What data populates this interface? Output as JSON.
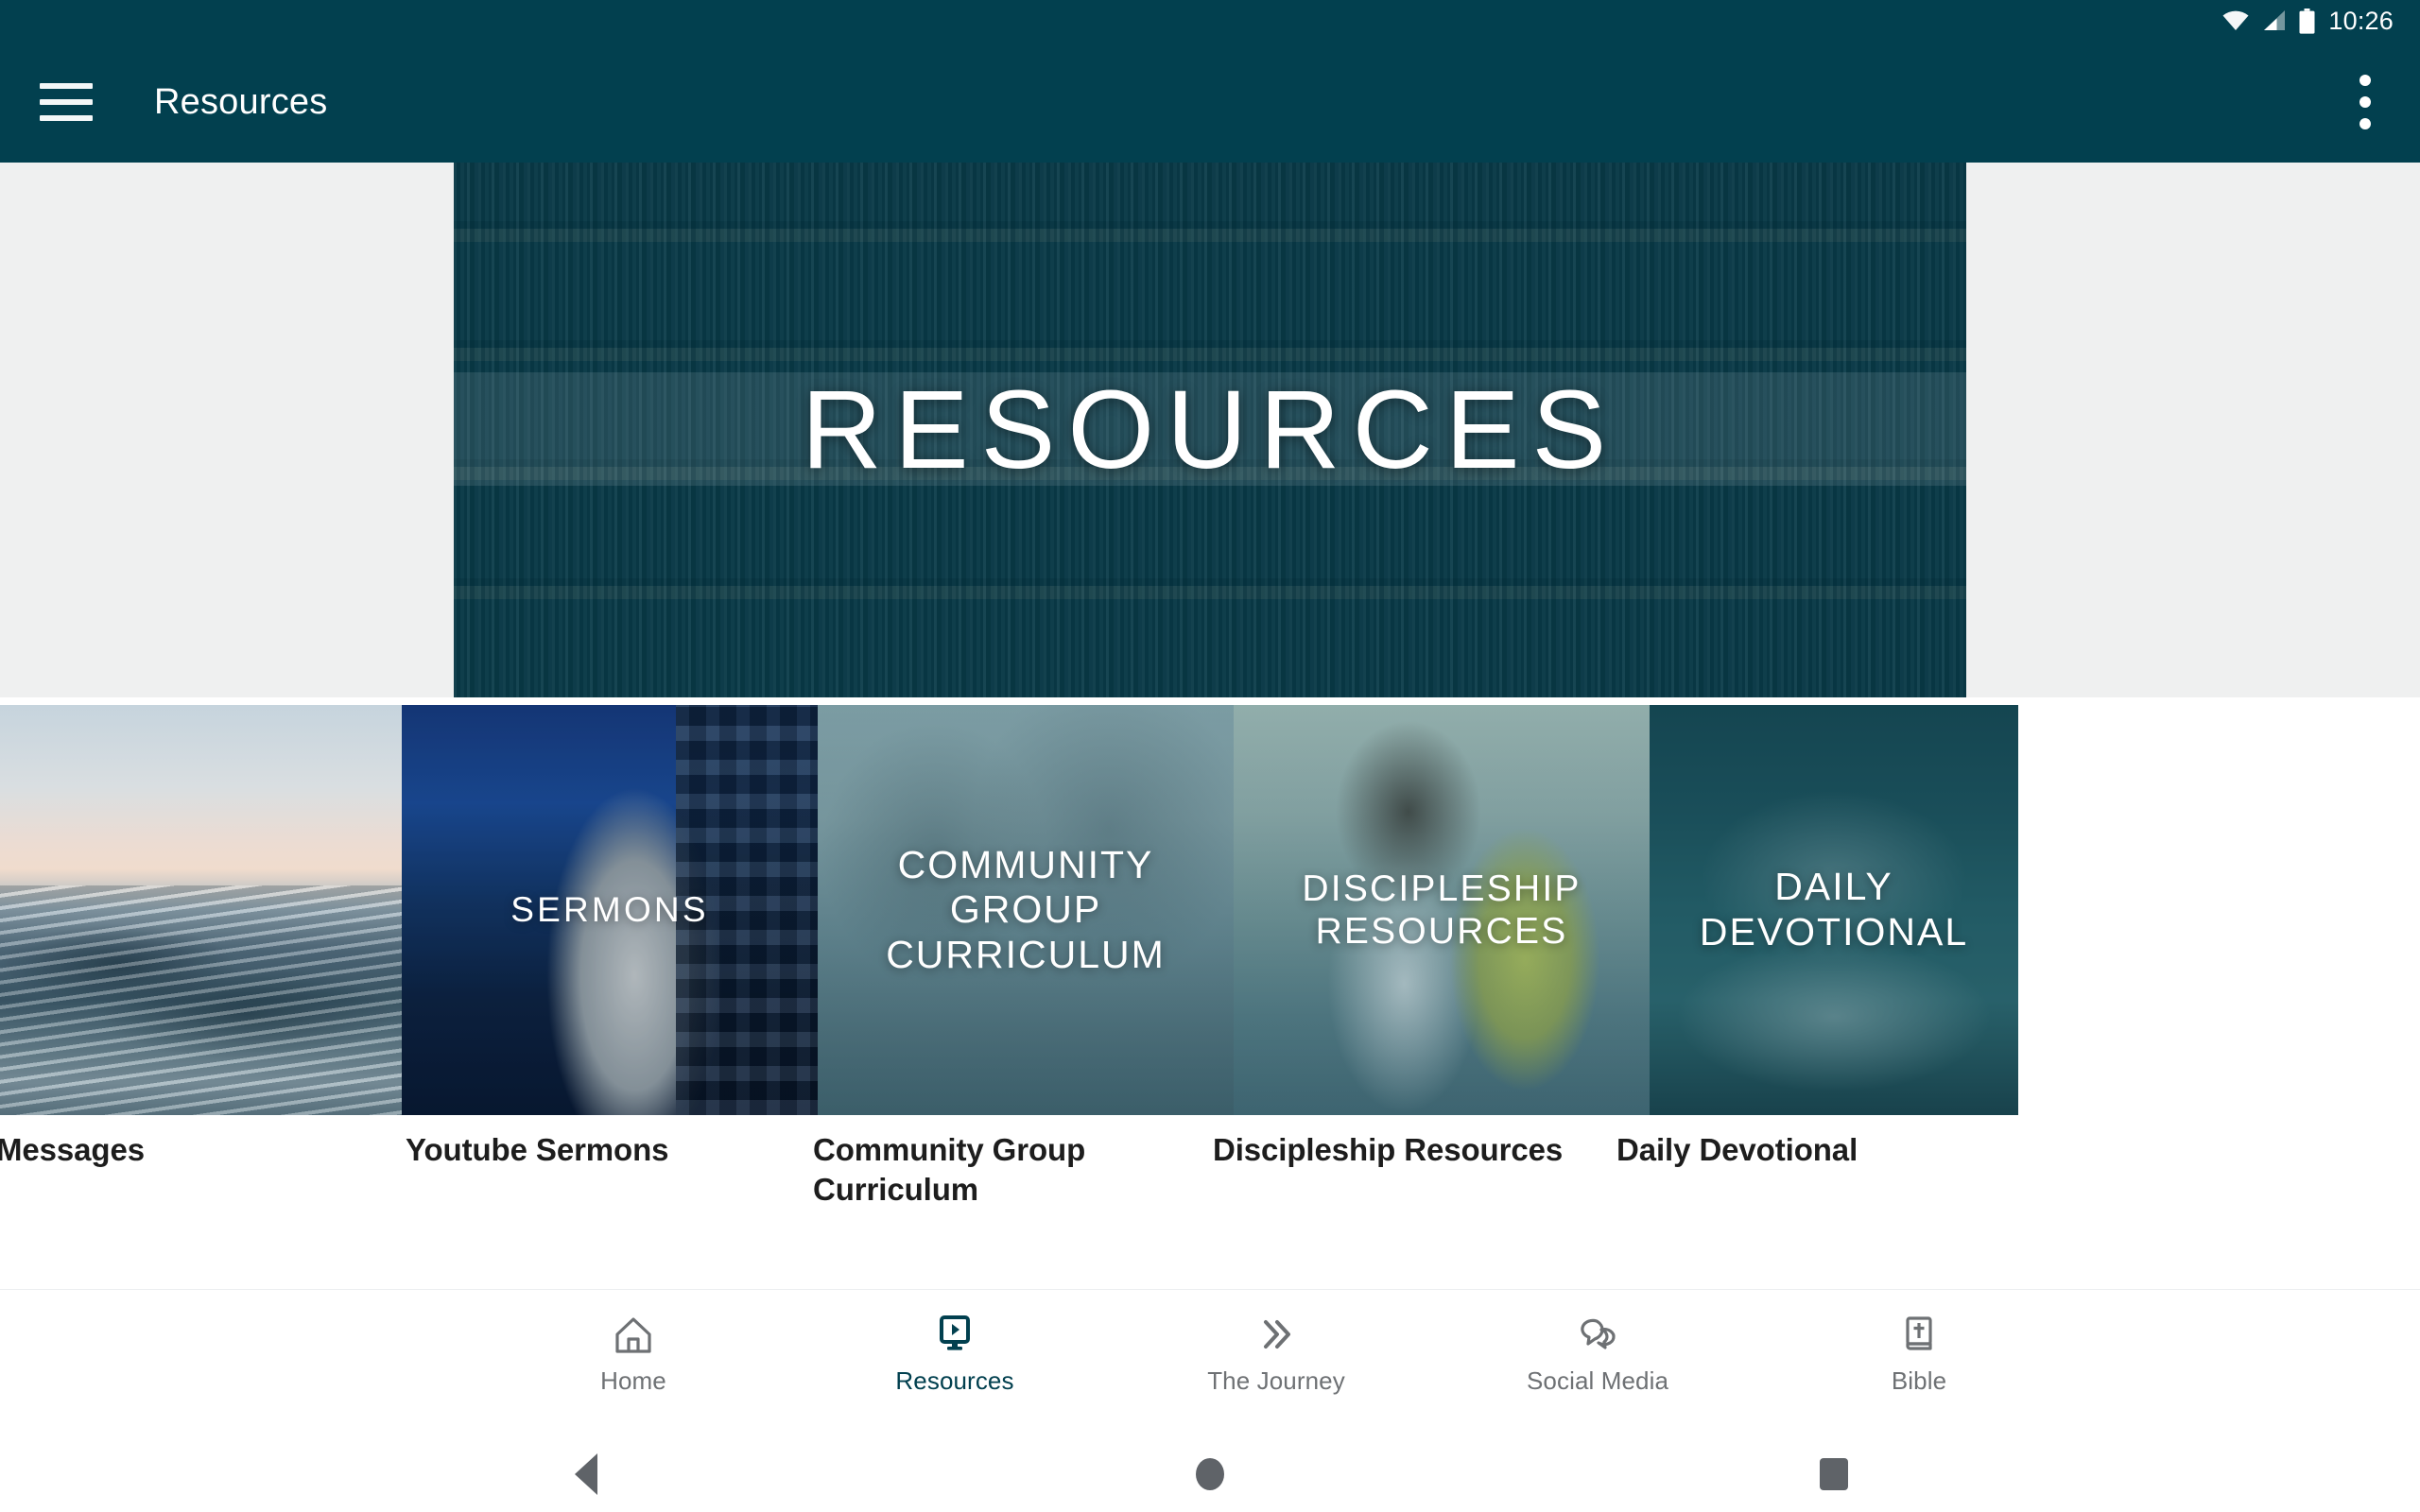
{
  "status_bar": {
    "time": "10:26",
    "icons": [
      "wifi-icon",
      "cell-signal-icon",
      "battery-icon"
    ]
  },
  "app_bar": {
    "menu_icon": "hamburger-menu-icon",
    "title": "Resources",
    "overflow_icon": "more-vert-icon"
  },
  "hero": {
    "title": "RESOURCES",
    "image_description": "bookshelf-library-photo"
  },
  "cards": [
    {
      "overlay_lines": [],
      "label": "Messages",
      "image_description": "ocean-waves-photo"
    },
    {
      "overlay_lines": [
        "SERMONS"
      ],
      "label": "Youtube Sermons",
      "image_description": "preacher-on-stage-photo"
    },
    {
      "overlay_lines": [
        "COMMUNITY",
        "GROUP",
        "CURRICULUM"
      ],
      "label": "Community Group Curriculum",
      "image_description": "small-group-meeting-photo"
    },
    {
      "overlay_lines": [
        "DISCIPLESHIP",
        "RESOURCES"
      ],
      "label": "Discipleship Resources",
      "image_description": "two-young-people-talking-photo"
    },
    {
      "overlay_lines": [
        "DAILY",
        "DEVOTIONAL"
      ],
      "label": "Daily Devotional",
      "image_description": "hands-folded-over-open-bible-photo"
    }
  ],
  "bottom_nav": {
    "items": [
      {
        "label": "Home",
        "icon": "home-icon",
        "active": false
      },
      {
        "label": "Resources",
        "icon": "video-monitor-icon",
        "active": true
      },
      {
        "label": "The Journey",
        "icon": "double-chevron-right-icon",
        "active": false
      },
      {
        "label": "Social Media",
        "icon": "chat-bubbles-icon",
        "active": false
      },
      {
        "label": "Bible",
        "icon": "bible-book-icon",
        "active": false
      }
    ]
  },
  "system_bar": {
    "back": "back-triangle-icon",
    "home": "home-circle-icon",
    "recents": "recents-square-icon"
  },
  "colors": {
    "brand_teal": "#02404f",
    "page_background": "#ffffff",
    "hero_gutter": "#eff0f0",
    "nav_inactive": "#6e7174",
    "label_text": "#1d1d1d"
  }
}
